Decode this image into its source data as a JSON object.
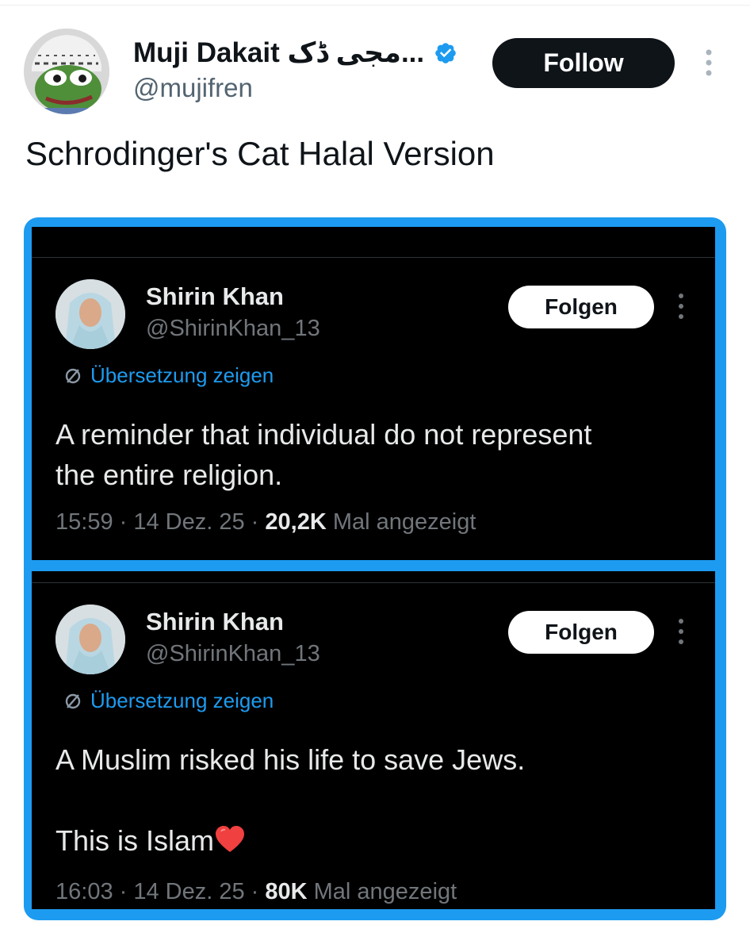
{
  "tweet": {
    "author_name": "Muji Dakait مجی ڈک...",
    "author_handle": "@mujifren",
    "verified": true,
    "follow_label": "Follow",
    "text": "Schrodinger's Cat Halal Version",
    "avatar_icon": "pepe-frog-avatar",
    "more_icon": "more-vertical-icon"
  },
  "embedded": [
    {
      "name": "Shirin Khan",
      "handle": "@ShirinKhan_13",
      "follow_label": "Folgen",
      "translate_label": "Übersetzung zeigen",
      "text_line1": "A reminder that individual do not represent",
      "text_line2": "the entire religion.",
      "meta_prefix": "15:59 · 14 Dez. 25 · ",
      "views": "20,2K",
      "meta_suffix": " Mal angezeigt"
    },
    {
      "name": "Shirin Khan",
      "handle": "@ShirinKhan_13",
      "follow_label": "Folgen",
      "translate_label": "Übersetzung zeigen",
      "text_line1": "A Muslim risked his life to save Jews.",
      "text_line2": "This is Islam",
      "meta_prefix": "16:03 · 14 Dez. 25 · ",
      "views": "80K",
      "meta_suffix": " Mal angezeigt"
    }
  ],
  "colors": {
    "accent": "#1d9bf0",
    "text_primary": "#0f1419",
    "text_secondary": "#536471",
    "dark_bg": "#000000",
    "heart": "#f91880"
  }
}
